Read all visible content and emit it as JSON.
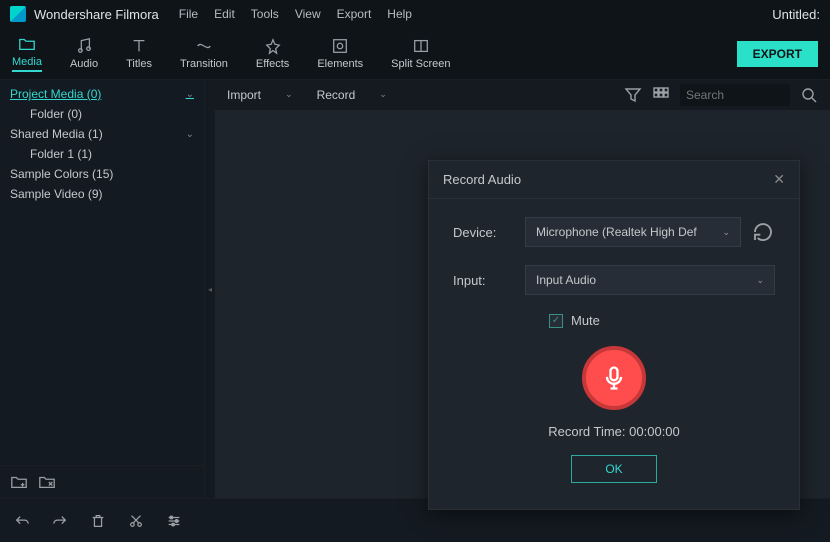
{
  "app": {
    "name": "Wondershare Filmora",
    "document": "Untitled:"
  },
  "menubar": [
    "File",
    "Edit",
    "Tools",
    "View",
    "Export",
    "Help"
  ],
  "toolbar": [
    {
      "label": "Media",
      "icon": "folder-icon",
      "active": true
    },
    {
      "label": "Audio",
      "icon": "music-icon",
      "active": false
    },
    {
      "label": "Titles",
      "icon": "text-icon",
      "active": false
    },
    {
      "label": "Transition",
      "icon": "transition-icon",
      "active": false
    },
    {
      "label": "Effects",
      "icon": "effects-icon",
      "active": false
    },
    {
      "label": "Elements",
      "icon": "elements-icon",
      "active": false
    },
    {
      "label": "Split Screen",
      "icon": "splitscreen-icon",
      "active": false
    }
  ],
  "export_label": "EXPORT",
  "sidebar": {
    "items": [
      {
        "label": "Project Media (0)",
        "selected": true,
        "expandable": true
      },
      {
        "label": "Folder (0)",
        "indent": true
      },
      {
        "label": "Shared Media (1)",
        "expandable": true
      },
      {
        "label": "Folder 1 (1)",
        "indent": true
      },
      {
        "label": "Sample Colors (15)"
      },
      {
        "label": "Sample Video (9)"
      }
    ]
  },
  "contentbar": {
    "import_label": "Import",
    "record_label": "Record",
    "search_placeholder": "Search"
  },
  "dialog": {
    "title": "Record Audio",
    "device_label": "Device:",
    "device_value": "Microphone (Realtek High Def",
    "input_label": "Input:",
    "input_value": "Input Audio",
    "mute_label": "Mute",
    "mute_checked": true,
    "record_time_label": "Record Time:",
    "record_time_value": "00:00:00",
    "ok_label": "OK"
  }
}
